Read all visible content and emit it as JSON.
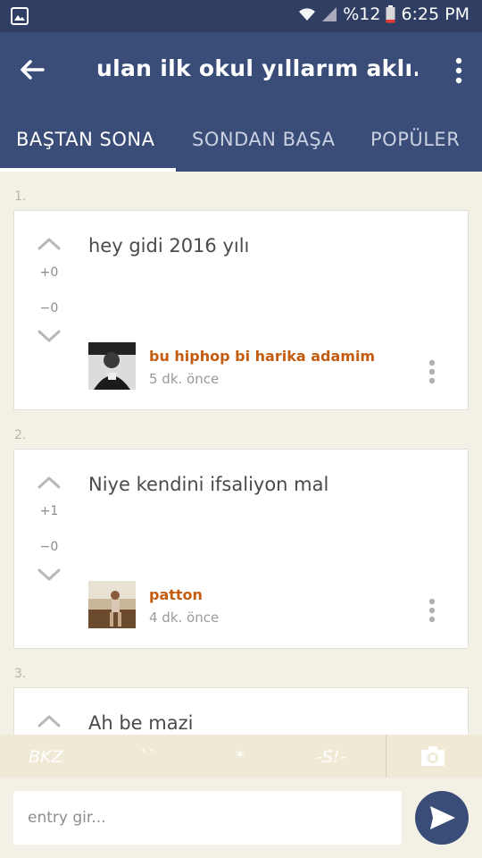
{
  "status_bar": {
    "battery_text": "%12",
    "time": "6:25 PM"
  },
  "app_bar": {
    "title": "ulan ilk okul yıllarım aklı..."
  },
  "tabs": [
    {
      "label": "BAŞTAN SONA",
      "active": true
    },
    {
      "label": "SONDAN BAŞA",
      "active": false
    },
    {
      "label": "POPÜLER",
      "active": false
    }
  ],
  "entries": [
    {
      "number": "1.",
      "text": "hey gidi 2016 yılı",
      "up_count": "+0",
      "down_count": "−0",
      "author": "bu hiphop bi harika adamim",
      "time": "5 dk. önce"
    },
    {
      "number": "2.",
      "text": "Niye kendini ifsaliyon mal",
      "up_count": "+1",
      "down_count": "−0",
      "author": "patton",
      "time": "4 dk. önce"
    },
    {
      "number": "3.",
      "text": "Ah be mazi"
    }
  ],
  "toolbar": {
    "bkz": "BKZ",
    "backticks": "``",
    "asterisk": "*",
    "spoiler": "-S!-"
  },
  "input": {
    "placeholder": "entry gir..."
  },
  "colors": {
    "primary": "#3a4d78",
    "status_bar": "#2f3e62",
    "author": "#c45c10",
    "background": "#f3f0e6"
  }
}
